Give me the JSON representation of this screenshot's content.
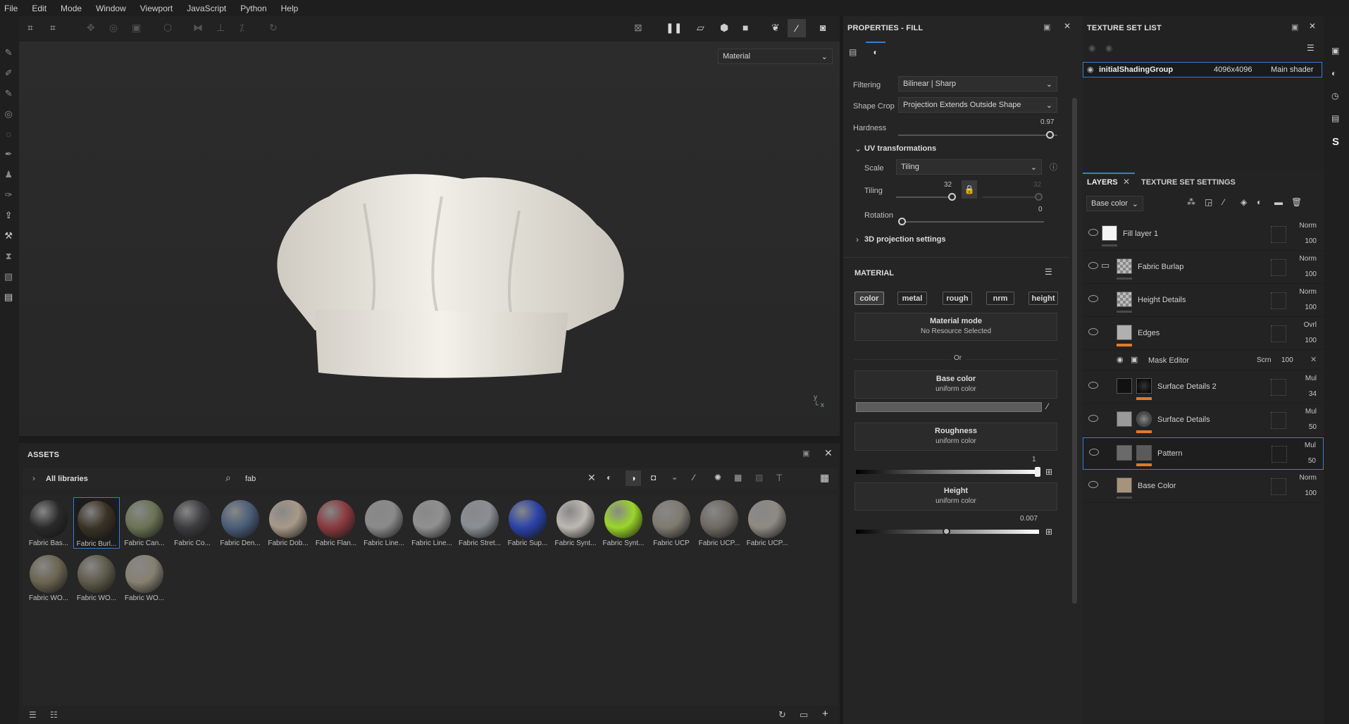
{
  "menu": [
    "File",
    "Edit",
    "Mode",
    "Window",
    "Viewport",
    "JavaScript",
    "Python",
    "Help"
  ],
  "viewport": {
    "mode_select": "Material"
  },
  "properties": {
    "title": "PROPERTIES - FILL",
    "filtering_label": "Filtering",
    "filtering_value": "Bilinear | Sharp",
    "shape_crop_label": "Shape Crop",
    "shape_crop_value": "Projection Extends Outside Shape",
    "hardness_label": "Hardness",
    "hardness_value": "0.97",
    "hardness_level": 0.97,
    "uv_section": "UV transformations",
    "scale_label": "Scale",
    "scale_value": "Tiling",
    "tiling_label": "Tiling",
    "tiling_value": "32",
    "tiling_value2": "32",
    "rotation_label": "Rotation",
    "rotation_value": "0",
    "projection_section": "3D projection settings",
    "material_section": "MATERIAL",
    "channels": [
      "color",
      "metal",
      "rough",
      "nrm",
      "height"
    ],
    "material_mode_title": "Material mode",
    "material_mode_sub": "No Resource Selected",
    "or_text": "Or",
    "base_color_title": "Base color",
    "base_color_sub": "uniform color",
    "roughness_title": "Roughness",
    "roughness_sub": "uniform color",
    "roughness_value": "1",
    "height_title": "Height",
    "height_sub": "uniform color",
    "height_value": "0.007"
  },
  "texture_set_list": {
    "title": "TEXTURE SET LIST",
    "set_name": "initialShadingGroup",
    "set_size": "4096x4096",
    "set_shader": "Main shader"
  },
  "layers_panel": {
    "tab_layers": "LAYERS",
    "tab_settings": "TEXTURE SET SETTINGS",
    "channel_select": "Base color",
    "layers": [
      {
        "name": "Fill layer 1",
        "blend": "Norm",
        "opacity": "100"
      },
      {
        "name": "Fabric Burlap",
        "blend": "Norm",
        "opacity": "100"
      },
      {
        "name": "Height Details",
        "blend": "Norm",
        "opacity": "100"
      },
      {
        "name": "Edges",
        "blend": "Ovrl",
        "opacity": "100"
      },
      {
        "name": "Surface Details 2",
        "blend": "Mul",
        "opacity": "34"
      },
      {
        "name": "Surface Details",
        "blend": "Mul",
        "opacity": "50"
      },
      {
        "name": "Pattern",
        "blend": "Mul",
        "opacity": "50"
      },
      {
        "name": "Base Color",
        "blend": "Norm",
        "opacity": "100"
      }
    ],
    "mask_editor": {
      "name": "Mask Editor",
      "blend": "Scrn",
      "opacity": "100"
    }
  },
  "assets": {
    "title": "ASSETS",
    "libraries": "All libraries",
    "search_value": "fab",
    "items": [
      {
        "name": "Fabric Bas...",
        "color": "#2a2a2a"
      },
      {
        "name": "Fabric Burl...",
        "color": "#3a3226"
      },
      {
        "name": "Fabric Can...",
        "color": "#6b7355"
      },
      {
        "name": "Fabric Co...",
        "color": "#3c3c3e"
      },
      {
        "name": "Fabric Den...",
        "color": "#4a5d78"
      },
      {
        "name": "Fabric Dob...",
        "color": "#a89988"
      },
      {
        "name": "Fabric Flan...",
        "color": "#8a3a3e"
      },
      {
        "name": "Fabric Line...",
        "color": "#8a8a8a"
      },
      {
        "name": "Fabric Line...",
        "color": "#909090"
      },
      {
        "name": "Fabric Stret...",
        "color": "#8a8e94"
      },
      {
        "name": "Fabric Sup...",
        "color": "#2b43a8"
      },
      {
        "name": "Fabric Synt...",
        "color": "#bdb8b2"
      },
      {
        "name": "Fabric Synt...",
        "color": "#9ad62a"
      },
      {
        "name": "Fabric UCP",
        "color": "#7e7a70"
      },
      {
        "name": "Fabric UCP...",
        "color": "#6e6a62"
      },
      {
        "name": "Fabric UCP...",
        "color": "#8e8a82"
      },
      {
        "name": "Fabric WO...",
        "color": "#6a6450"
      },
      {
        "name": "Fabric WO...",
        "color": "#5e5a4a"
      },
      {
        "name": "Fabric WO...",
        "color": "#858070"
      }
    ]
  },
  "colors": {
    "accent": "#3a7bd5",
    "orange": "#e07a2c"
  }
}
